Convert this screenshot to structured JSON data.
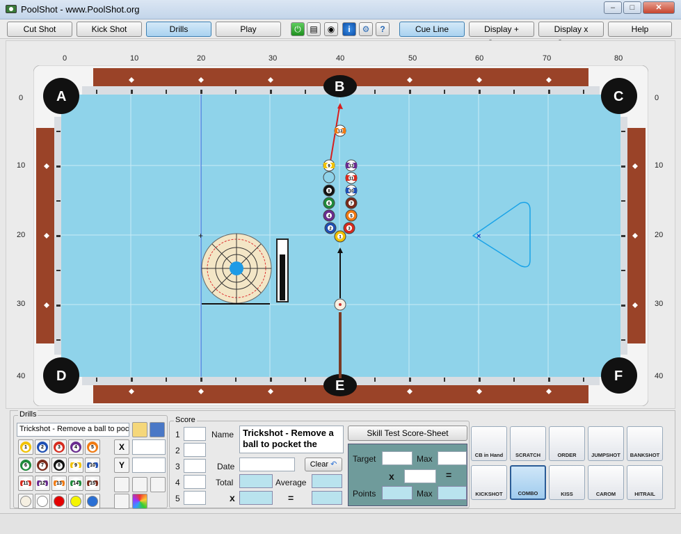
{
  "window": {
    "title": "PoolShot - www.PoolShot.org",
    "minimize": "–",
    "maximize": "□",
    "close": "✕"
  },
  "toolbar": {
    "cut_shot": "Cut Shot",
    "kick_shot": "Kick Shot",
    "drills": "Drills",
    "play": "Play",
    "cue_line": "Cue Line",
    "display_plus": "Display + System",
    "display_x": "Display x System",
    "help": "Help",
    "power_icon": "⏻",
    "print_icon": "▤",
    "camera_icon": "◉",
    "info_icon": "i",
    "settings_icon": "⚙",
    "help_doc_icon": "?"
  },
  "ruler": {
    "x": [
      "0",
      "10",
      "20",
      "30",
      "40",
      "50",
      "60",
      "70",
      "80"
    ],
    "y": [
      "0",
      "10",
      "20",
      "30",
      "40"
    ]
  },
  "pockets": {
    "a": "A",
    "b": "B",
    "c": "C",
    "d": "D",
    "e": "E",
    "f": "F"
  },
  "balls_on_table": [
    "13",
    "9",
    "12",
    "11",
    "8",
    "10",
    "6",
    "7",
    "4",
    "5",
    "2",
    "3",
    "1"
  ],
  "drills": {
    "legend": "Drills",
    "selected": "Trickshot - Remove a ball to poc",
    "x_label": "X",
    "y_label": "Y",
    "balls": [
      "1",
      "2",
      "3",
      "4",
      "5",
      "6",
      "7",
      "8",
      "9",
      "10",
      "11",
      "12",
      "13",
      "14",
      "15"
    ]
  },
  "score": {
    "legend": "Score",
    "rows": [
      "1",
      "2",
      "3",
      "4",
      "5"
    ],
    "name_label": "Name",
    "name_value": "Trickshot - Remove a ball to pocket the",
    "date_label": "Date",
    "clear_label": "Clear",
    "total_label": "Total",
    "average_label": "Average",
    "x_label": "x",
    "eq_label": "=",
    "skill_test": "Skill Test Score-Sheet",
    "target_label": "Target",
    "max_label": "Max",
    "points_label": "Points",
    "max2_label": "Max",
    "x2_label": "x",
    "eq2_label": "="
  },
  "shots": {
    "cb_in_hand": "CB in Hand",
    "scratch": "SCRATCH",
    "order": "ORDER",
    "jumpshot": "JUMPSHOT",
    "bankshot": "BANKSHOT",
    "kickshot": "KICKSHOT",
    "combo": "COMBO",
    "kiss": "KISS",
    "carom": "CAROM",
    "hitrail": "HITRAIL"
  },
  "colors": {
    "felt": "#8fd3ea",
    "rail": "#9a4328",
    "active_button": "#a9d2f0",
    "aim_line": "#d61e1e"
  }
}
